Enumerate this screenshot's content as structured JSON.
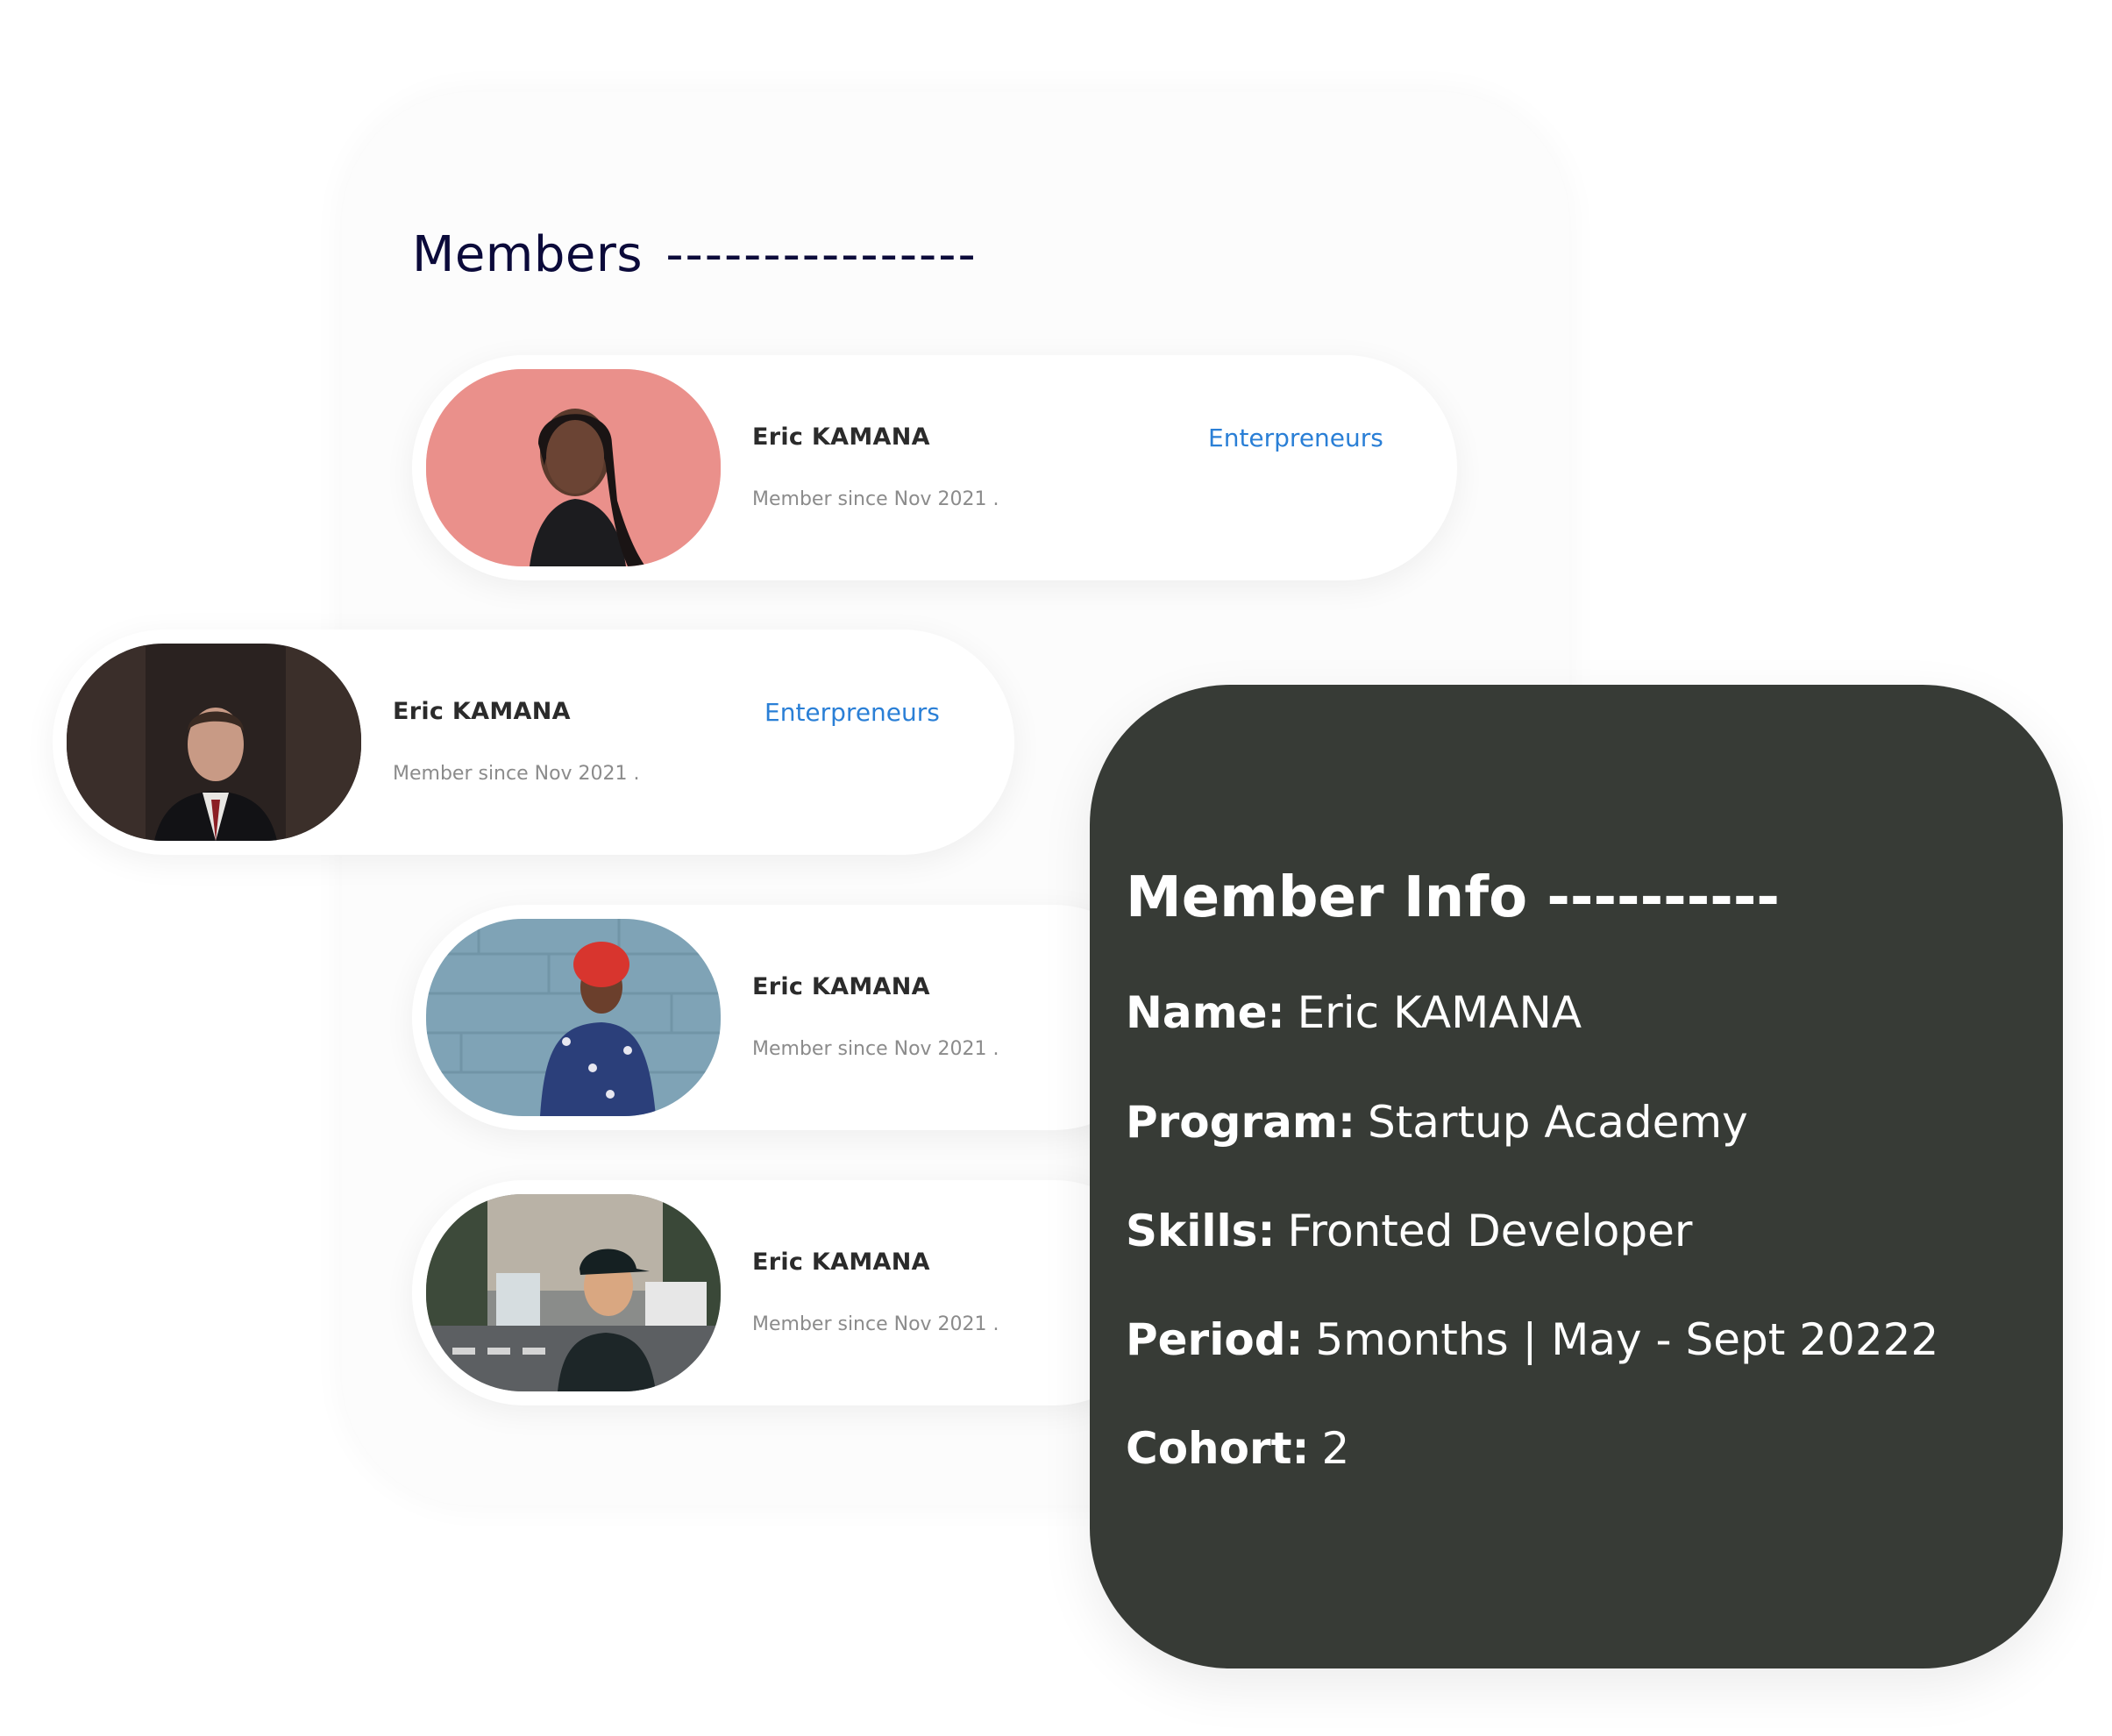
{
  "members": {
    "title": "Members",
    "title_dashes": "----------------",
    "list": [
      {
        "name": "Eric KAMANA",
        "since": "Member since Nov 2021 .",
        "program": "Enterpreneurs"
      },
      {
        "name": "Eric KAMANA",
        "since": "Member since Nov 2021 .",
        "program": "Enterpreneurs"
      },
      {
        "name": "Eric KAMANA",
        "since": "Member since Nov 2021 ."
      },
      {
        "name": "Eric KAMANA",
        "since": "Member since Nov 2021 ."
      }
    ]
  },
  "info": {
    "title": "Member Info",
    "title_dashes": "----------",
    "name_label": "Name:",
    "name_value": "Eric KAMANA",
    "program_label": "Program:",
    "program_value": "Startup Academy",
    "skills_label": "Skills:",
    "skills_value": "Fronted Developer",
    "period_label": "Period:",
    "period_value": "5months | May - Sept 20222",
    "cohort_label": "Cohort:",
    "cohort_value": "2"
  },
  "colors": {
    "title": "#0b0a3a",
    "link": "#2a7fd6",
    "info_bg": "#373b36"
  }
}
